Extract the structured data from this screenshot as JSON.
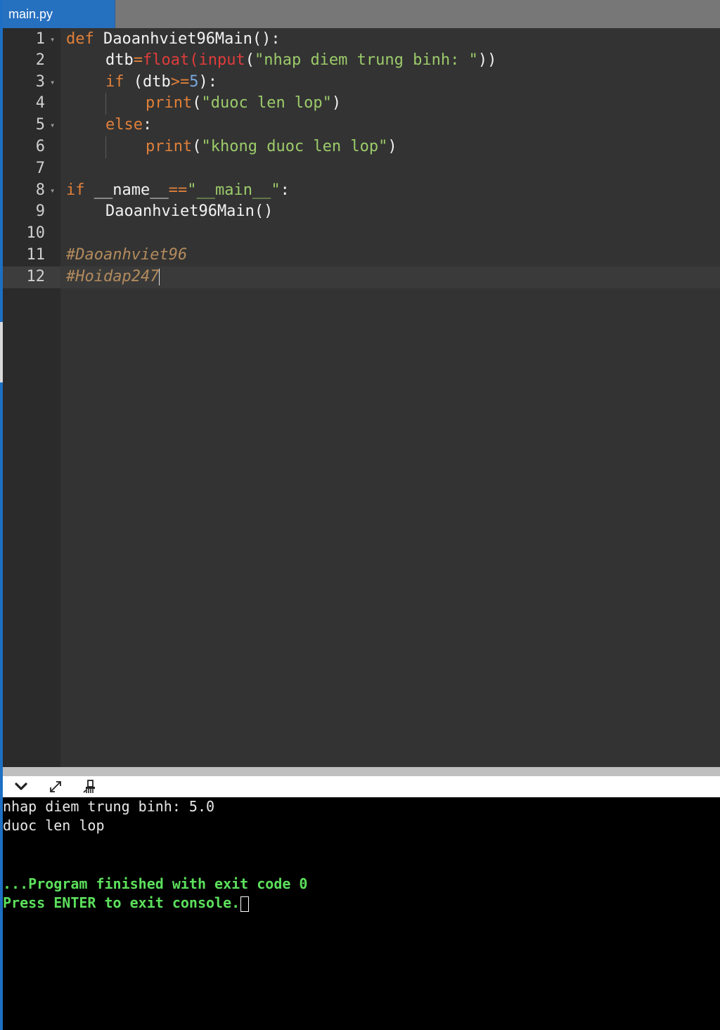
{
  "tab": {
    "filename": "main.py"
  },
  "editor": {
    "line_numbers": [
      "1",
      "2",
      "3",
      "4",
      "5",
      "6",
      "7",
      "8",
      "9",
      "10",
      "11",
      "12"
    ],
    "lines": {
      "l1": {
        "kw_def": "def",
        "fn_name": " Daoanhviet96Main",
        "rest": "():"
      },
      "l2": {
        "var": "dtb",
        "eq": "=",
        "float": "float",
        "lp": "(",
        "input": "input",
        "lp2": "(",
        "str": "\"nhap diem trung binh: \"",
        "rp": "))"
      },
      "l3": {
        "kw_if": "if",
        "open": " (dtb",
        "op": ">=",
        "num": "5",
        "close": "):"
      },
      "l4": {
        "print": "print",
        "lp": "(",
        "str": "\"duoc len lop\"",
        "rp": ")"
      },
      "l5": {
        "kw_else": "else",
        "colon": ":"
      },
      "l6": {
        "print": "print",
        "lp": "(",
        "str": "\"khong duoc len lop\"",
        "rp": ")"
      },
      "l8": {
        "kw_if": "if",
        "name": " __name__",
        "op": "==",
        "str": "\"__main__\"",
        "colon": ":"
      },
      "l9": {
        "call": "Daoanhviet96Main()"
      },
      "l11": {
        "comment": "#Daoanhviet96"
      },
      "l12": {
        "comment": "#Hoidap247"
      }
    }
  },
  "console_toolbar": {
    "collapse_icon": "chevron-down-icon",
    "expand_icon": "expand-icon",
    "clear_icon": "clear-console-icon"
  },
  "console": {
    "line1": "nhap diem trung binh: 5.0",
    "line2": "duoc len lop",
    "line3": "...Program finished with exit code 0",
    "line4": "Press ENTER to exit console."
  },
  "colors": {
    "keyword": "#e0803a",
    "builtin": "#e03c3c",
    "string": "#9ccb6a",
    "number": "#7aa8e0",
    "comment": "#b38b5d",
    "tab_active": "#2670c0",
    "console_green": "#5ce05c"
  }
}
